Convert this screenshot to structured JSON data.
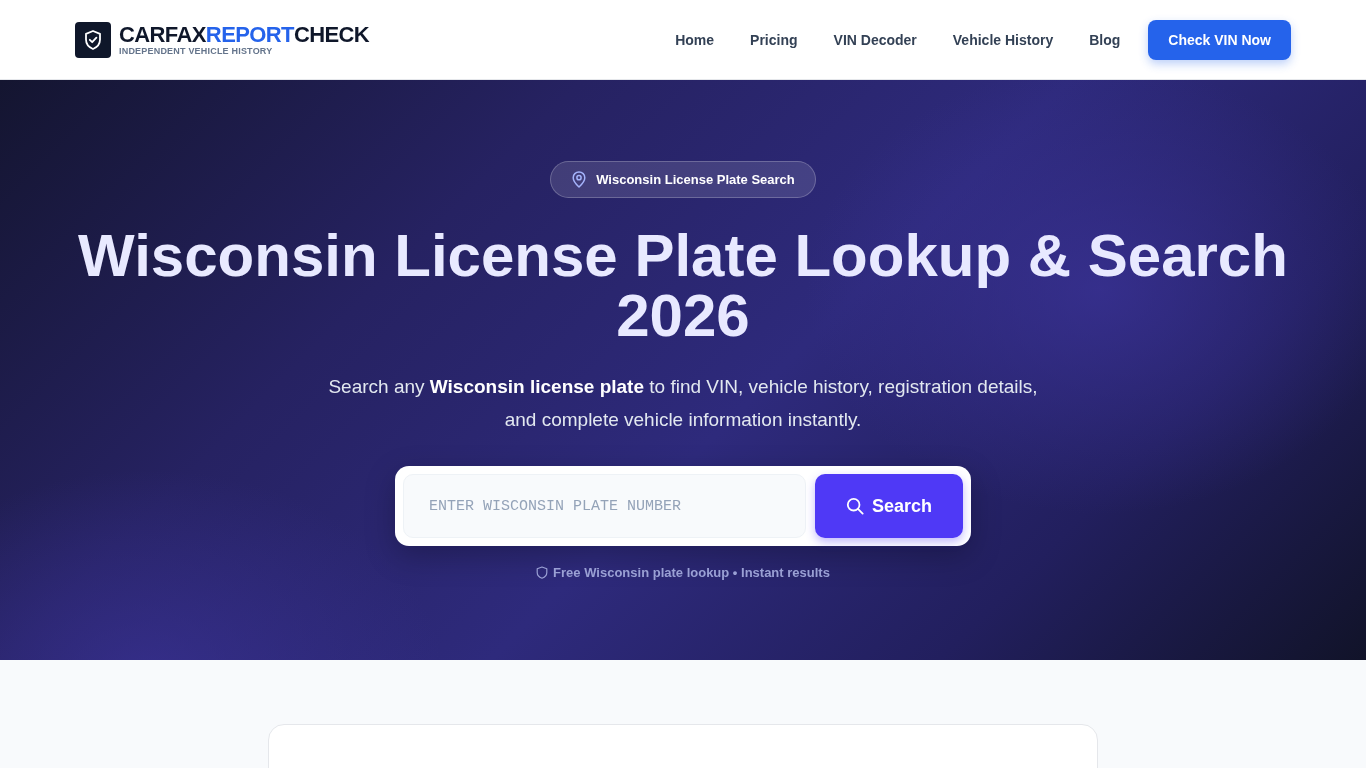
{
  "header": {
    "brand": {
      "parts": [
        {
          "text": "CARFAX",
          "kind": "plain"
        },
        {
          "text": "REPORT",
          "kind": "accent"
        },
        {
          "text": "CHECK",
          "kind": "plain"
        }
      ]
    },
    "tagline": "INDEPENDENT VEHICLE HISTORY",
    "nav": [
      "Home",
      "Pricing",
      "VIN Decoder",
      "Vehicle History",
      "Blog"
    ],
    "cta": "Check VIN Now"
  },
  "hero": {
    "badge": "Wisconsin License Plate Search",
    "title": "Wisconsin License Plate Lookup & Search 2026",
    "subtitle": "Search any **Wisconsin license plate** to find VIN, vehicle history, registration details, and complete vehicle information instantly.",
    "search": {
      "placeholder": "ENTER WISCONSIN PLATE NUMBER",
      "button": "Search"
    },
    "note": "Free Wisconsin plate lookup • Instant results"
  }
}
